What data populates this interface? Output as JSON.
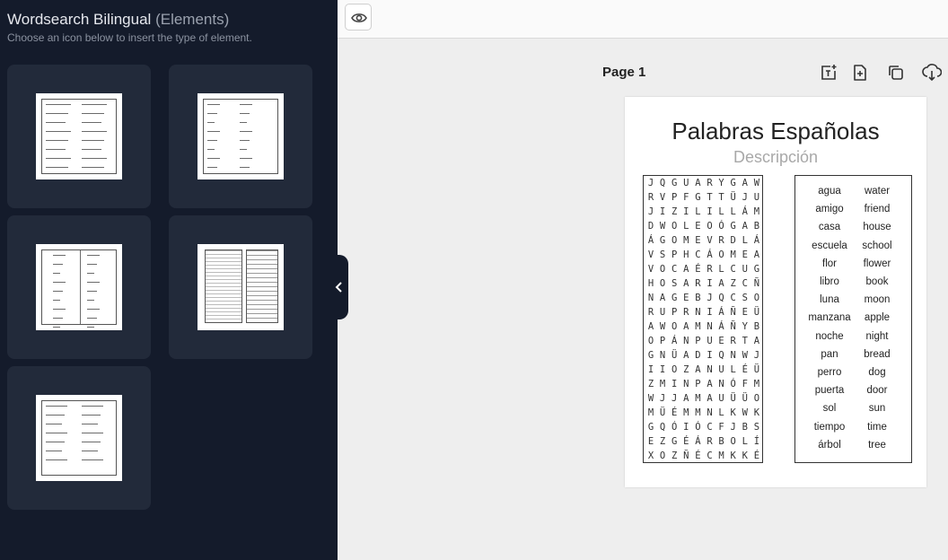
{
  "sidebar": {
    "title": "Wordsearch Bilingual",
    "title_suffix": "(Elements)",
    "subtitle": "Choose an icon below to insert the type of element."
  },
  "toolbar": {
    "preview_icon": "eye-icon",
    "collapse_icon": "chevron-left-icon"
  },
  "page_header": {
    "label": "Page 1",
    "icons": [
      "add-text-icon",
      "add-page-icon",
      "duplicate-icon",
      "download-icon"
    ]
  },
  "document": {
    "title": "Palabras Españolas",
    "description": "Descripción",
    "grid": [
      "JQGUARYGAW",
      "RVPFGTTÜJU",
      "JIZILILLÁM",
      "DWOLEOÓGAB",
      "ÁGOMEVRDLÁ",
      "VSPHCÁOMEA",
      "VOCAÉRLCUG",
      "HOSARIAZCÑ",
      "NAGEBJQCSO",
      "RUPRNIÁÑEÜ",
      "AWOAMNÁÑYB",
      "OPÁNPUERTA",
      "GNÜADIQNWJ",
      "IIOZANULÉÜ",
      "ZMINPANÓFM",
      "WJJAMAUÜÜO",
      "MÜÉMMNLKWK",
      "GQÓIÓCFJBS",
      "EZGÉÁRBOLÍ",
      "XOZÑÉCMKKÉ"
    ],
    "word_pairs": [
      [
        "agua",
        "water"
      ],
      [
        "amigo",
        "friend"
      ],
      [
        "casa",
        "house"
      ],
      [
        "escuela",
        "school"
      ],
      [
        "flor",
        "flower"
      ],
      [
        "libro",
        "book"
      ],
      [
        "luna",
        "moon"
      ],
      [
        "manzana",
        "apple"
      ],
      [
        "noche",
        "night"
      ],
      [
        "pan",
        "bread"
      ],
      [
        "perro",
        "dog"
      ],
      [
        "puerta",
        "door"
      ],
      [
        "sol",
        "sun"
      ],
      [
        "tiempo",
        "time"
      ],
      [
        "árbol",
        "tree"
      ]
    ]
  }
}
